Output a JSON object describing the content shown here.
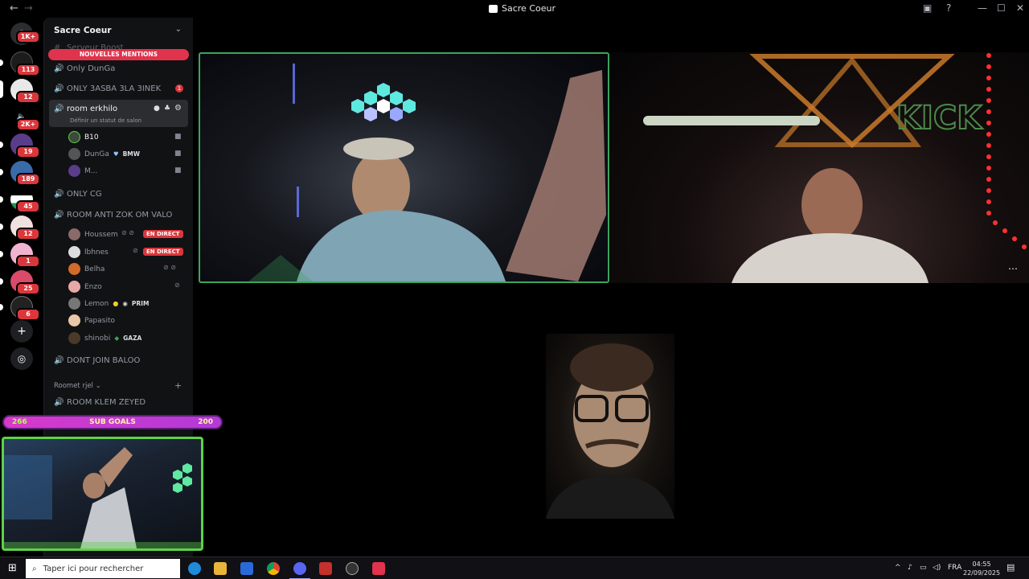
{
  "window": {
    "title": "Sacre Coeur",
    "back": "←",
    "forward": "→"
  },
  "rail": {
    "badges": [
      "1K+",
      "113",
      "12",
      "2K+",
      "19",
      "189",
      "45",
      "12",
      "1",
      "25",
      "6"
    ]
  },
  "server": {
    "name": "Sacre Coeur",
    "mentions_banner": "NOUVELLES MENTIONS",
    "partial_channel": "Serveur Boost",
    "channels": [
      {
        "name": "Only DunGa"
      },
      {
        "name": "ONLY 3ASBA 3LA 3INEK",
        "count": "1"
      },
      {
        "name": "room erkhilo",
        "status": "Définir un statut de salon"
      },
      {
        "name": "ONLY CG"
      },
      {
        "name": "ROOM ANTI ZOK OM VALO"
      },
      {
        "name": "DONT JOIN BALOO"
      }
    ],
    "room_erkhilo_users": [
      {
        "name": "B10"
      },
      {
        "name": "DunGa",
        "tag": "BMW"
      },
      {
        "name": "M..."
      }
    ],
    "room_anti_users": [
      {
        "name": "Houssem",
        "live": "EN DIRECT"
      },
      {
        "name": "lbhnes",
        "live": "EN DIRECT"
      },
      {
        "name": "Belha"
      },
      {
        "name": "Enzo"
      },
      {
        "name": "Lemon",
        "tag": "PRIM"
      },
      {
        "name": "Papasito"
      },
      {
        "name": "shinobi",
        "tag": "GAZA"
      }
    ],
    "category": "Roomet rjel",
    "category_channel": "ROOM KLEM ZEYED"
  },
  "overlay": {
    "sub_goals_label": "SUB GOALS",
    "sub_goals_current": "266",
    "sub_goals_target": "200"
  },
  "taskbar": {
    "search_placeholder": "Taper ici pour rechercher",
    "language": "FRA",
    "time": "04:55",
    "date": "22/09/2025"
  },
  "colors": {
    "accent_live": "#da373c",
    "speaking_border": "#3ba55c",
    "sub_goals": "#d63ac9"
  }
}
